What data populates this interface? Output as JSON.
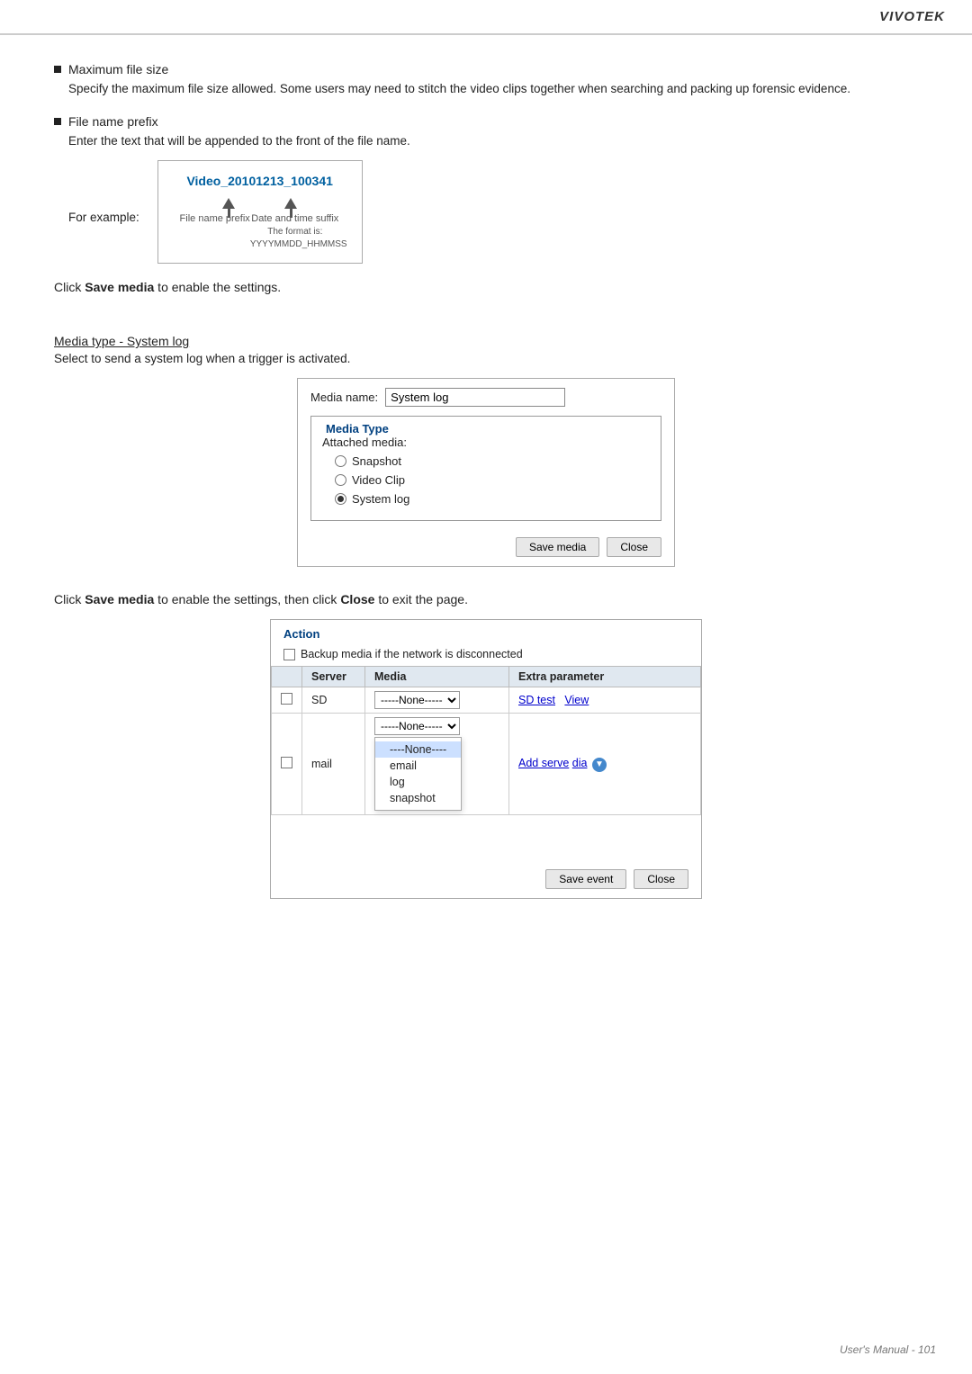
{
  "header": {
    "brand": "VIVOTEK"
  },
  "section1": {
    "bullet1_heading": "Maximum file size",
    "bullet1_body": "Specify the maximum file size allowed. Some users may need to stitch the video clips together when searching and packing up forensic evidence.",
    "bullet2_heading": "File name prefix",
    "bullet2_body": "Enter the text that will be appended to the front of the file name.",
    "for_example": "For example:",
    "example_filename": "Video_20101213_100341",
    "label_prefix": "File name prefix",
    "label_datetime": "Date and time suffix",
    "label_format": "The format is: YYYYMMDD_HHMMSS"
  },
  "save_media_text1": "Click ",
  "save_media_bold1": "Save media",
  "save_media_text2": " to enable the settings.",
  "media_type_heading": "Media type - System log",
  "media_type_desc": "Select to send a system log when a trigger is activated.",
  "dialog": {
    "media_name_label": "Media name:",
    "media_name_value": "System log",
    "fieldset_legend": "Media Type",
    "attached_media_label": "Attached media:",
    "options": [
      {
        "label": "Snapshot",
        "selected": false
      },
      {
        "label": "Video Clip",
        "selected": false
      },
      {
        "label": "System log",
        "selected": true
      }
    ],
    "save_button": "Save media",
    "close_button": "Close"
  },
  "save_close_text1": "Click ",
  "save_close_bold1": "Save media",
  "save_close_text2": " to enable the settings, then click ",
  "save_close_bold2": "Close",
  "save_close_text3": " to exit the page.",
  "action_box": {
    "legend": "Action",
    "backup_label": "Backup media if the network is disconnected",
    "table": {
      "headers": [
        "Server",
        "Media",
        "Extra parameter"
      ],
      "rows": [
        {
          "server": "SD",
          "media_select": "-----None-----",
          "extra": [
            "SD test",
            "View"
          ]
        },
        {
          "server": "mail",
          "media_select": "-----None-----",
          "extra": []
        }
      ]
    },
    "dropdown_items": [
      "----None----",
      "email",
      "log",
      "snapshot"
    ],
    "dropdown_selected": "----None----",
    "add_server_label": "Add serve",
    "add_media_partial": "dia",
    "save_event_button": "Save event",
    "close_button": "Close"
  },
  "footer": {
    "text": "User's Manual - 101"
  }
}
